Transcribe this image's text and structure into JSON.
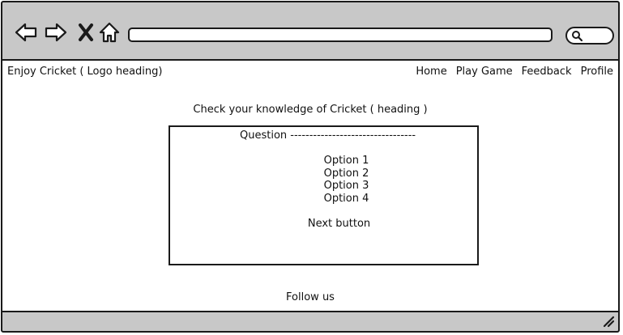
{
  "browser": {
    "address": "",
    "nav_icons": [
      "back-arrow-icon",
      "forward-arrow-icon",
      "close-x-icon",
      "home-icon"
    ],
    "search_icon": "search-icon"
  },
  "header": {
    "logo": "Enjoy Cricket ( Logo heading)",
    "nav": [
      "Home",
      "Play Game",
      "Feedback",
      "Profile"
    ]
  },
  "main": {
    "heading": "Check your knowledge of Cricket ( heading )",
    "quiz": {
      "question": "Question ---------------------------------",
      "options": [
        "Option 1",
        "Option 2",
        "Option 3",
        "Option 4"
      ],
      "next_button": "Next button"
    }
  },
  "footer": {
    "text": "Follow us"
  },
  "colors": {
    "chrome": "#c8c8c8",
    "stroke": "#1a1a1a",
    "content_bg": "#ffffff"
  }
}
